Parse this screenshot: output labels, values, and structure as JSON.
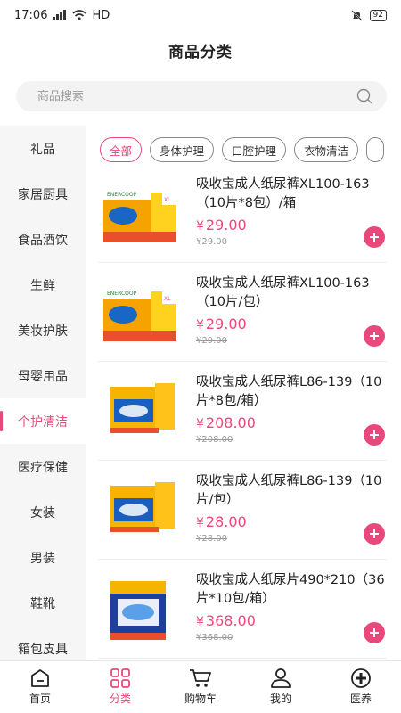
{
  "status_bar": {
    "time": "17:06",
    "network": "HD",
    "battery": "92"
  },
  "header": {
    "title": "商品分类"
  },
  "search": {
    "placeholder": "商品搜索"
  },
  "categories": [
    "礼品",
    "家居厨具",
    "食品酒饮",
    "生鲜",
    "美妆护肤",
    "母婴用品",
    "个护清洁",
    "医疗保健",
    "女装",
    "男装",
    "鞋靴",
    "箱包皮具"
  ],
  "active_category": "个护清洁",
  "tags": [
    "全部",
    "身体护理",
    "口腔护理",
    "衣物清洁"
  ],
  "active_tag": "全部",
  "products": [
    {
      "name": "吸收宝成人纸尿裤XL100-163（10片*8包）/箱",
      "price": "29.00",
      "original_price": "¥29.00",
      "currency": "¥",
      "image": "diaper-pack-xl"
    },
    {
      "name": "吸收宝成人纸尿裤XL100-163（10片/包）",
      "price": "29.00",
      "original_price": "¥29.00",
      "currency": "¥",
      "image": "diaper-pack-xl"
    },
    {
      "name": "吸收宝成人纸尿裤L86-139（10片*8包/箱）",
      "price": "208.00",
      "original_price": "¥208.00",
      "currency": "¥",
      "image": "diaper-pack-l"
    },
    {
      "name": "吸收宝成人纸尿裤L86-139（10片/包）",
      "price": "28.00",
      "original_price": "¥28.00",
      "currency": "¥",
      "image": "diaper-pack-l"
    },
    {
      "name": "吸收宝成人纸尿片490*210（36片*10包/箱）",
      "price": "368.00",
      "original_price": "¥368.00",
      "currency": "¥",
      "image": "diaper-pad-pack"
    }
  ],
  "tabbar": [
    {
      "label": "首页",
      "icon": "home-icon"
    },
    {
      "label": "分类",
      "icon": "grid-icon"
    },
    {
      "label": "购物车",
      "icon": "cart-icon"
    },
    {
      "label": "我的",
      "icon": "user-icon"
    },
    {
      "label": "医养",
      "icon": "medical-cross-icon"
    }
  ],
  "active_tab": "分类",
  "colors": {
    "accent": "#e8487a",
    "sidebar_bg": "#f6f6f6"
  }
}
